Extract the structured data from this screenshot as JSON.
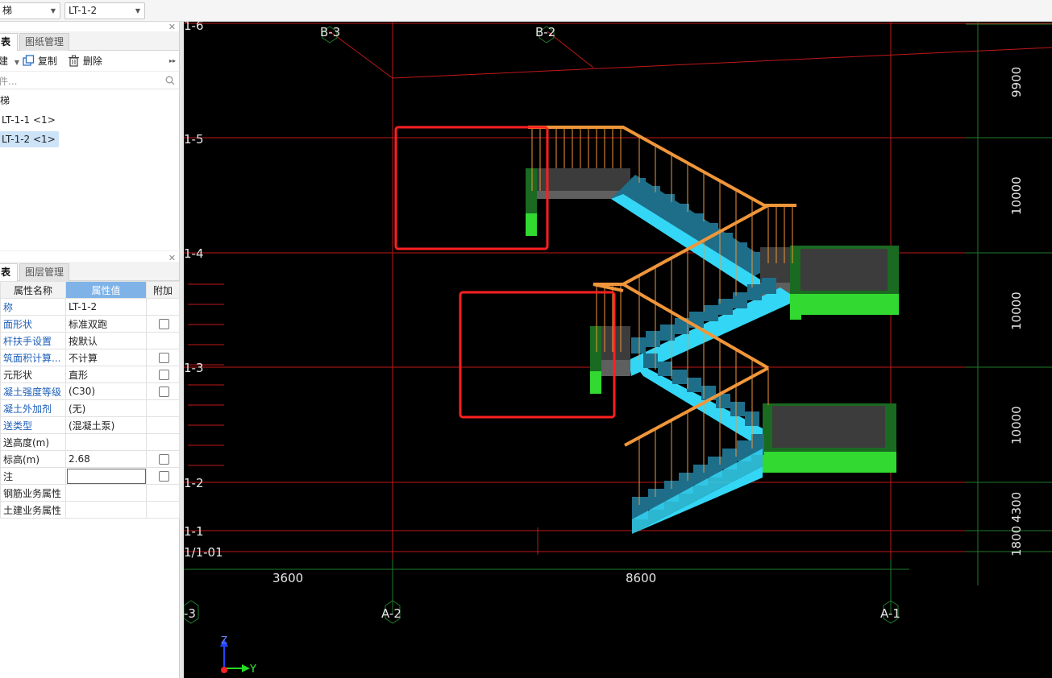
{
  "topbar": {
    "combo_left": "梯",
    "combo_right": "LT-1-2"
  },
  "list_panel": {
    "tab_active": "表",
    "tab_inactive": "图纸管理",
    "toolbar": {
      "new_label": "建",
      "copy_label": "复制",
      "delete_label": "删除"
    },
    "search_placeholder": "件...",
    "tree": {
      "root": "梯",
      "items": [
        "LT-1-1 <1>",
        "LT-1-2 <1>"
      ]
    }
  },
  "props_panel": {
    "tab_active": "表",
    "tab_inactive": "图层管理",
    "headers": [
      "属性名称",
      "属性值",
      "附加"
    ],
    "rows": [
      {
        "name": "称",
        "value": "LT-1-2",
        "checkbox": false,
        "link": true
      },
      {
        "name": "面形状",
        "value": "标准双跑",
        "checkbox": true,
        "link": true
      },
      {
        "name": "杆扶手设置",
        "value": "按默认",
        "checkbox": false,
        "link": true
      },
      {
        "name": "筑面积计算...",
        "value": "不计算",
        "checkbox": true,
        "link": true
      },
      {
        "name": "元形状",
        "value": "直形",
        "checkbox": true,
        "link": false
      },
      {
        "name": "凝土强度等级",
        "value": "(C30)",
        "checkbox": true,
        "link": true
      },
      {
        "name": "凝土外加剂",
        "value": "(无)",
        "checkbox": false,
        "link": true
      },
      {
        "name": "送类型",
        "value": "(混凝土泵)",
        "checkbox": false,
        "link": true
      },
      {
        "name": "送高度(m)",
        "value": "",
        "checkbox": false,
        "link": false
      },
      {
        "name": "标高(m)",
        "value": "2.68",
        "checkbox": true,
        "link": false
      },
      {
        "name": "注",
        "value": "",
        "checkbox": true,
        "link": false,
        "editing": true
      },
      {
        "name": "钢筋业务属性",
        "value": "",
        "checkbox": false,
        "link": false
      },
      {
        "name": "土建业务属性",
        "value": "",
        "checkbox": false,
        "link": false
      }
    ]
  },
  "canvas": {
    "grid_top_labels": [
      "B-3",
      "B-2"
    ],
    "grid_left_labels": [
      "1-6",
      "1-5",
      "1-4",
      "1-3",
      "1-2",
      "1-1",
      "1/1-01"
    ],
    "grid_bottom_labels": [
      "-3",
      "A-2",
      "A-1"
    ],
    "bottom_dims": [
      "3600",
      "8600"
    ],
    "right_dims": [
      "9900",
      "10000",
      "10000",
      "10000",
      "4300",
      "1800"
    ],
    "axis_z": "Z",
    "axis_y": "Y",
    "colors": {
      "grid_red": "#c01818",
      "grid_green": "#1f7a2a",
      "stair_cyan": "#34d6f5",
      "stair_blue": "#1e6e8a",
      "railing_orange": "#f0963a",
      "landing_green": "#31d931",
      "landing_dark": "#3c3c3c",
      "highlight_red": "#ff2020"
    }
  }
}
